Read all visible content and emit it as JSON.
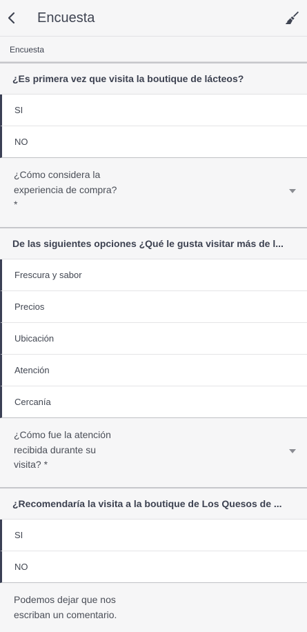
{
  "header": {
    "title": "Encuesta"
  },
  "breadcrumb": "Encuesta",
  "q1": {
    "title": "¿Es primera vez que visita la boutique de lácteos?",
    "options": [
      "SI",
      "NO"
    ]
  },
  "q2": {
    "line1": "¿Cómo considera la",
    "line2": "experiencia de compra?",
    "line3": "*"
  },
  "q3": {
    "title": "De las siguientes opciones ¿Qué le gusta visitar más de l...",
    "options": [
      "Frescura y sabor",
      "Precios",
      "Ubicación",
      "Atención",
      "Cercanía"
    ]
  },
  "q4": {
    "line1": "¿Cómo fue la atención",
    "line2": "recibida durante su",
    "line3": "visita? *"
  },
  "q5": {
    "title": "¿Recomendaría la visita a la boutique de Los Quesos de ...",
    "options": [
      "SI",
      "NO"
    ]
  },
  "comment": {
    "line1": "Podemos dejar que nos",
    "line2": "escriban un comentario."
  },
  "icons": {
    "back": "back-arrow-icon",
    "brush": "brush-icon",
    "caret": "chevron-down-icon"
  }
}
